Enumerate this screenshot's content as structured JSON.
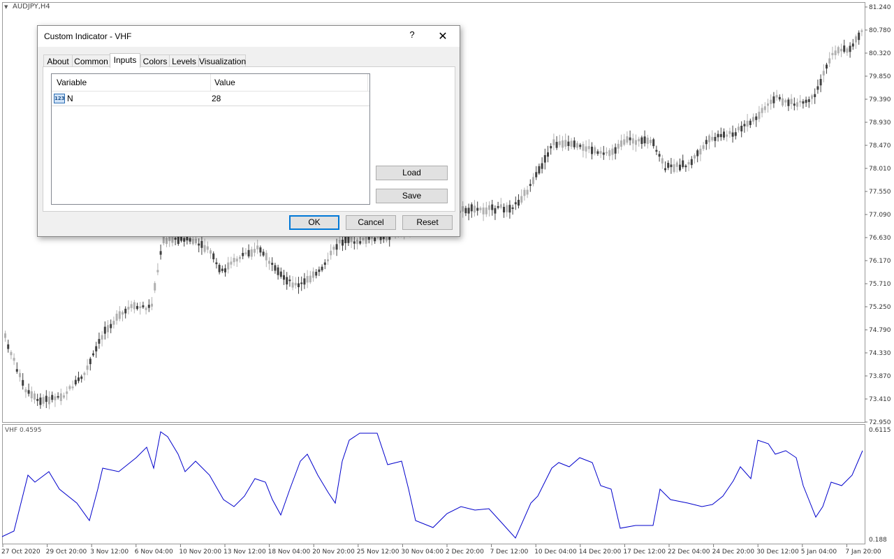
{
  "chart": {
    "symbol": "AUDJPY,H4",
    "price_axis": [
      "81.240",
      "80.780",
      "80.320",
      "79.850",
      "79.390",
      "78.930",
      "78.470",
      "78.010",
      "77.550",
      "77.090",
      "76.630",
      "76.170",
      "75.710",
      "75.250",
      "74.790",
      "74.330",
      "73.870",
      "73.410",
      "72.950"
    ],
    "indicator_label": "VHF 0.4595",
    "indicator_axis": [
      "0.6115",
      "0.188"
    ],
    "time_axis": [
      "27 Oct 2020",
      "29 Oct 20:00",
      "3 Nov 12:00",
      "6 Nov 04:00",
      "10 Nov 20:00",
      "13 Nov 12:00",
      "18 Nov 04:00",
      "20 Nov 20:00",
      "25 Nov 12:00",
      "30 Nov 04:00",
      "2 Dec 20:00",
      "7 Dec 12:00",
      "10 Dec 04:00",
      "14 Dec 20:00",
      "17 Dec 12:00",
      "22 Dec 04:00",
      "24 Dec 20:00",
      "30 Dec 12:00",
      "5 Jan 04:00",
      "7 Jan 20:00"
    ],
    "line_color": "#0000cc",
    "candle_bull_color": "#b0b0b0",
    "candle_bear_color": "#404040"
  },
  "dialog": {
    "title": "Custom Indicator - VHF",
    "help": "?",
    "close": "✕",
    "tabs": [
      "About",
      "Common",
      "Inputs",
      "Colors",
      "Levels",
      "Visualization"
    ],
    "active_tab": "Inputs",
    "table": {
      "headers": [
        "Variable",
        "Value"
      ],
      "rows": [
        {
          "type_icon": "123",
          "variable": "N",
          "value": "28"
        }
      ]
    },
    "buttons": {
      "load": "Load",
      "save": "Save",
      "ok": "OK",
      "cancel": "Cancel",
      "reset": "Reset"
    }
  }
}
